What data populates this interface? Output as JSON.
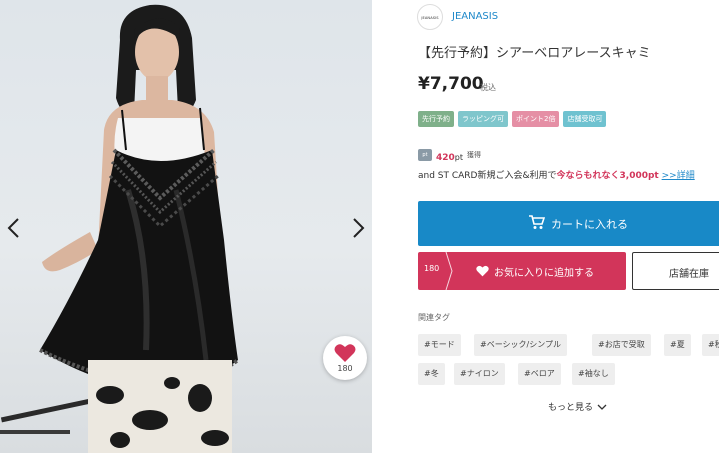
{
  "gallery": {
    "favorite_count": "180",
    "icons": {
      "prev": "chevron-left-icon",
      "next": "chevron-right-icon",
      "favorite": "heart-icon"
    }
  },
  "product": {
    "brand_logo_text": "JEANASIS",
    "brand_name": "JEANASIS",
    "title": "【先行予約】シアーベロアレースキャミ",
    "price": "¥7,700",
    "tax_label": "税込",
    "badges": [
      {
        "label": "先行予約",
        "color": "#7fb08a"
      },
      {
        "label": "ラッピング可",
        "color": "#7fc6cc"
      },
      {
        "label": "ポイント2倍",
        "color": "#e58fa5"
      },
      {
        "label": "店舗受取可",
        "color": "#6fc2d0"
      }
    ]
  },
  "points": {
    "icon": "points-icon",
    "icon_text": "pt",
    "value": "420",
    "unit": "pt",
    "suffix": "獲得"
  },
  "promo": {
    "prefix": "and ST CARD新規ご入会&利用で",
    "highlight": "今ならもれなく3,000pt",
    "link": ">>詳細"
  },
  "actions": {
    "cart_label": "カートに入れる",
    "cart_icon": "cart-icon",
    "favorite_count": "180",
    "favorite_label": "お気に入りに追加する",
    "stock_label": "店舗在庫"
  },
  "tags": {
    "heading": "関連タグ",
    "items": [
      "#モード",
      "#ベーシック/シンプル",
      "#お店で受取",
      "#夏",
      "#秋",
      "#冬",
      "#ナイロン",
      "#ベロア",
      "#袖なし"
    ],
    "more_label": "もっと見る"
  },
  "colors": {
    "accent_blue": "#1889c7",
    "favorite_pink": "#d2355a",
    "brand_link": "#1e88c9"
  }
}
